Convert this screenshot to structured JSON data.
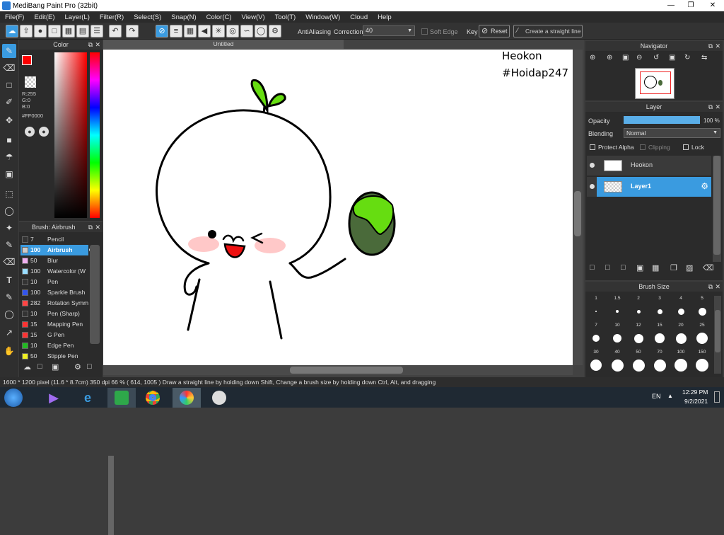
{
  "window": {
    "title": "MediBang Paint Pro (32bit)"
  },
  "menu": [
    "File(F)",
    "Edit(E)",
    "Layer(L)",
    "Filter(R)",
    "Select(S)",
    "Snap(N)",
    "Color(C)",
    "View(V)",
    "Tool(T)",
    "Window(W)",
    "Cloud",
    "Help"
  ],
  "toolbar": {
    "antialiasing_label": "AntiAliasing",
    "correction_label": "Correction",
    "correction_value": "40",
    "soft_edge_label": "Soft Edge",
    "key_label": "Key",
    "reset_label": "Reset",
    "straight_line_label": "Create a straight line"
  },
  "color_panel": {
    "title": "Color",
    "r": "R:255",
    "g": "G:0",
    "b": "B:0",
    "hex": "#FF0000",
    "primary": "#ff0000"
  },
  "brush_panel": {
    "title": "Brush: Airbrush",
    "items": [
      {
        "size": "7",
        "name": "Pencil",
        "color": "#333333"
      },
      {
        "size": "100",
        "name": "Airbrush",
        "color": "#cccccc"
      },
      {
        "size": "50",
        "name": "Blur",
        "color": "#f0b0f0"
      },
      {
        "size": "100",
        "name": "Watercolor (W",
        "color": "#99ddff"
      },
      {
        "size": "10",
        "name": "Pen",
        "color": "#333333"
      },
      {
        "size": "100",
        "name": "Sparkle Brush",
        "color": "#3355ee"
      },
      {
        "size": "282",
        "name": "Rotation Symm",
        "color": "#ff4444"
      },
      {
        "size": "10",
        "name": "Pen (Sharp)",
        "color": "#333333"
      },
      {
        "size": "15",
        "name": "Mapping Pen",
        "color": "#ff3333"
      },
      {
        "size": "15",
        "name": "G Pen",
        "color": "#ff3333"
      },
      {
        "size": "10",
        "name": "Edge Pen",
        "color": "#22bb22"
      },
      {
        "size": "50",
        "name": "Stipple Pen",
        "color": "#eeee22"
      }
    ]
  },
  "canvas": {
    "tab_title": "Untitled",
    "text_line1": "Heokon",
    "text_line2": "#Hoidap247"
  },
  "navigator": {
    "title": "Navigator"
  },
  "layer_panel": {
    "title": "Layer",
    "opacity_label": "Opacity",
    "opacity_value": "100 %",
    "opacity": 1.0,
    "blending_label": "Blending",
    "blending_value": "Normal",
    "protect_alpha": "Protect Alpha",
    "clipping": "Clipping",
    "lock": "Lock",
    "layers": [
      {
        "name": "Heokon",
        "selected": false
      },
      {
        "name": "Layer1",
        "selected": true
      }
    ]
  },
  "brush_size_panel": {
    "title": "Brush Size",
    "sizes": [
      "1",
      "1.5",
      "2",
      "3",
      "4",
      "5",
      "7",
      "10",
      "12",
      "15",
      "20",
      "25",
      "30",
      "40",
      "50",
      "70",
      "100",
      "150"
    ]
  },
  "status": {
    "text": "1600 * 1200 pixel  (11.6 * 8.7cm)  350 dpi  66 %  ( 614, 1005 )  Draw a straight line by holding down Shift, Change a brush size by holding down Ctrl, Alt, and dragging"
  },
  "taskbar": {
    "lang": "EN",
    "time": "12:29 PM",
    "date": "9/2/2021"
  },
  "colors": {
    "accent": "#3a9be0",
    "seedling_green": "#66dd11",
    "melon_dark": "#4a6a3a",
    "mouth_red": "#ee1111"
  }
}
